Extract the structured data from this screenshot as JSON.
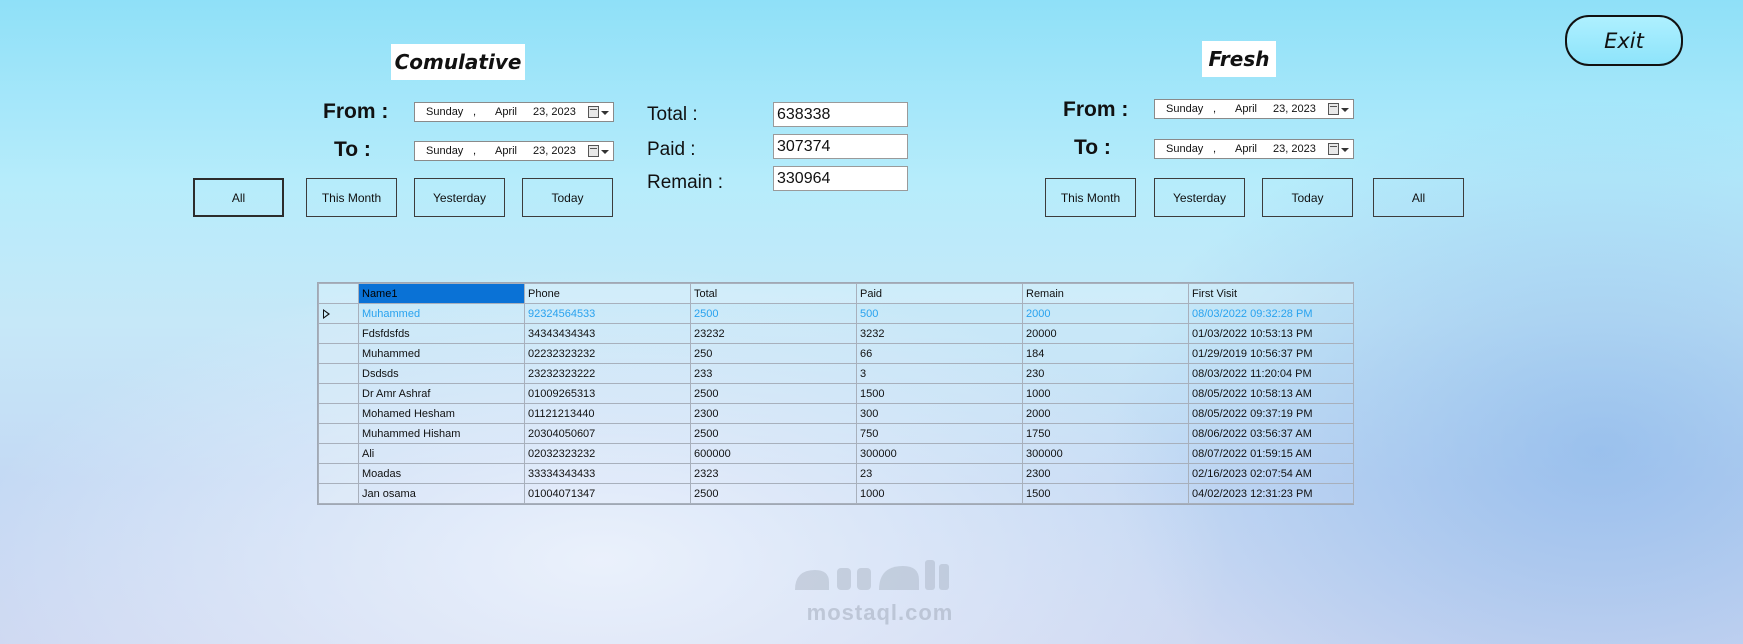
{
  "exit_label": "Exit",
  "cumulative": {
    "title": "Comulative",
    "from_label": "From :",
    "to_label": "To :",
    "from_date": {
      "day": "Sunday",
      "sep": ",",
      "month": "April",
      "rest": "23, 2023"
    },
    "to_date": {
      "day": "Sunday",
      "sep": ",",
      "month": "April",
      "rest": "23, 2023"
    },
    "buttons": {
      "all": "All",
      "this_month": "This Month",
      "yesterday": "Yesterday",
      "today": "Today"
    }
  },
  "summary": {
    "total_label": "Total :",
    "paid_label": "Paid :",
    "remain_label": "Remain :",
    "total_value": "638338",
    "paid_value": "307374",
    "remain_value": "330964"
  },
  "fresh": {
    "title": "Fresh",
    "from_label": "From :",
    "to_label": "To :",
    "from_date": {
      "day": "Sunday",
      "sep": ",",
      "month": "April",
      "rest": "23, 2023"
    },
    "to_date": {
      "day": "Sunday",
      "sep": ",",
      "month": "April",
      "rest": "23, 2023"
    },
    "buttons": {
      "this_month": "This Month",
      "yesterday": "Yesterday",
      "today": "Today",
      "all": "All"
    }
  },
  "grid": {
    "columns": [
      "Name1",
      "Phone",
      "Total",
      "Paid",
      "Remain",
      "First Visit"
    ],
    "rows": [
      [
        "Muhammed",
        "92324564533",
        "2500",
        "500",
        "2000",
        "08/03/2022 09:32:28 PM"
      ],
      [
        "Fdsfdsfds",
        "34343434343",
        "23232",
        "3232",
        "20000",
        "01/03/2022 10:53:13 PM"
      ],
      [
        "Muhammed",
        "02232323232",
        "250",
        "66",
        "184",
        "01/29/2019 10:56:37 PM"
      ],
      [
        "Dsdsds",
        "23232323222",
        "233",
        "3",
        "230",
        "08/03/2022 11:20:04 PM"
      ],
      [
        "Dr Amr Ashraf",
        "01009265313",
        "2500",
        "1500",
        "1000",
        "08/05/2022 10:58:13 AM"
      ],
      [
        "Mohamed Hesham",
        "01121213440",
        "2300",
        "300",
        "2000",
        "08/05/2022 09:37:19 PM"
      ],
      [
        "Muhammed Hisham",
        "20304050607",
        "2500",
        "750",
        "1750",
        "08/06/2022 03:56:37 AM"
      ],
      [
        "Ali",
        "02032323232",
        "600000",
        "300000",
        "300000",
        "08/07/2022 01:59:15 AM"
      ],
      [
        "Moadas",
        "33334343433",
        "2323",
        "23",
        "2300",
        "02/16/2023 02:07:54 AM"
      ],
      [
        "Jan osama",
        "01004071347",
        "2500",
        "1000",
        "1500",
        "04/02/2023 12:31:23 PM"
      ]
    ]
  },
  "watermark": {
    "text": "mostaql.com"
  }
}
